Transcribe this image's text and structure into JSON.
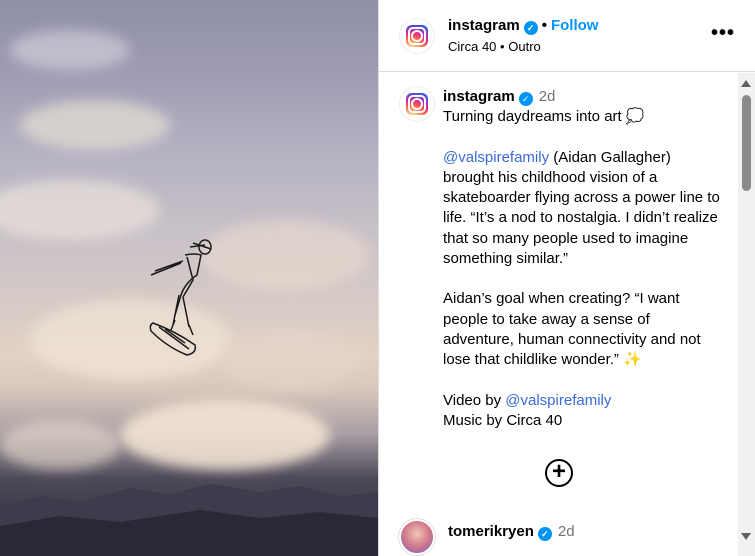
{
  "header": {
    "account_name": "instagram",
    "follow_label": "Follow",
    "separator": "•",
    "audio_title": "Circa 40",
    "audio_subtitle": "Outro",
    "audio_sep": "•",
    "more_label": "•••"
  },
  "caption": {
    "account_name": "instagram",
    "time": "2d",
    "line1": "Turning daydreams into art 💭",
    "mention1": "@valspirefamily",
    "para2_rest": " (Aidan Gallagher) brought his childhood vision of a skateboarder flying across a power line to life. “It’s a nod to nostalgia. I didn’t realize that so many people used to imagine something similar.”",
    "para3": "Aidan’s goal when creating? “I want people to take away a sense of adventure, human connectivity and not lose that childlike wonder.” ✨",
    "video_by": "Video by ",
    "mention2": "@valspirefamily",
    "music_by": "Music by Circa 40"
  },
  "add_label": "+",
  "comment": {
    "username": "tomerikryen",
    "time": "2d"
  },
  "colors": {
    "accent": "#0095f6",
    "mention": "#3a6bd6"
  }
}
